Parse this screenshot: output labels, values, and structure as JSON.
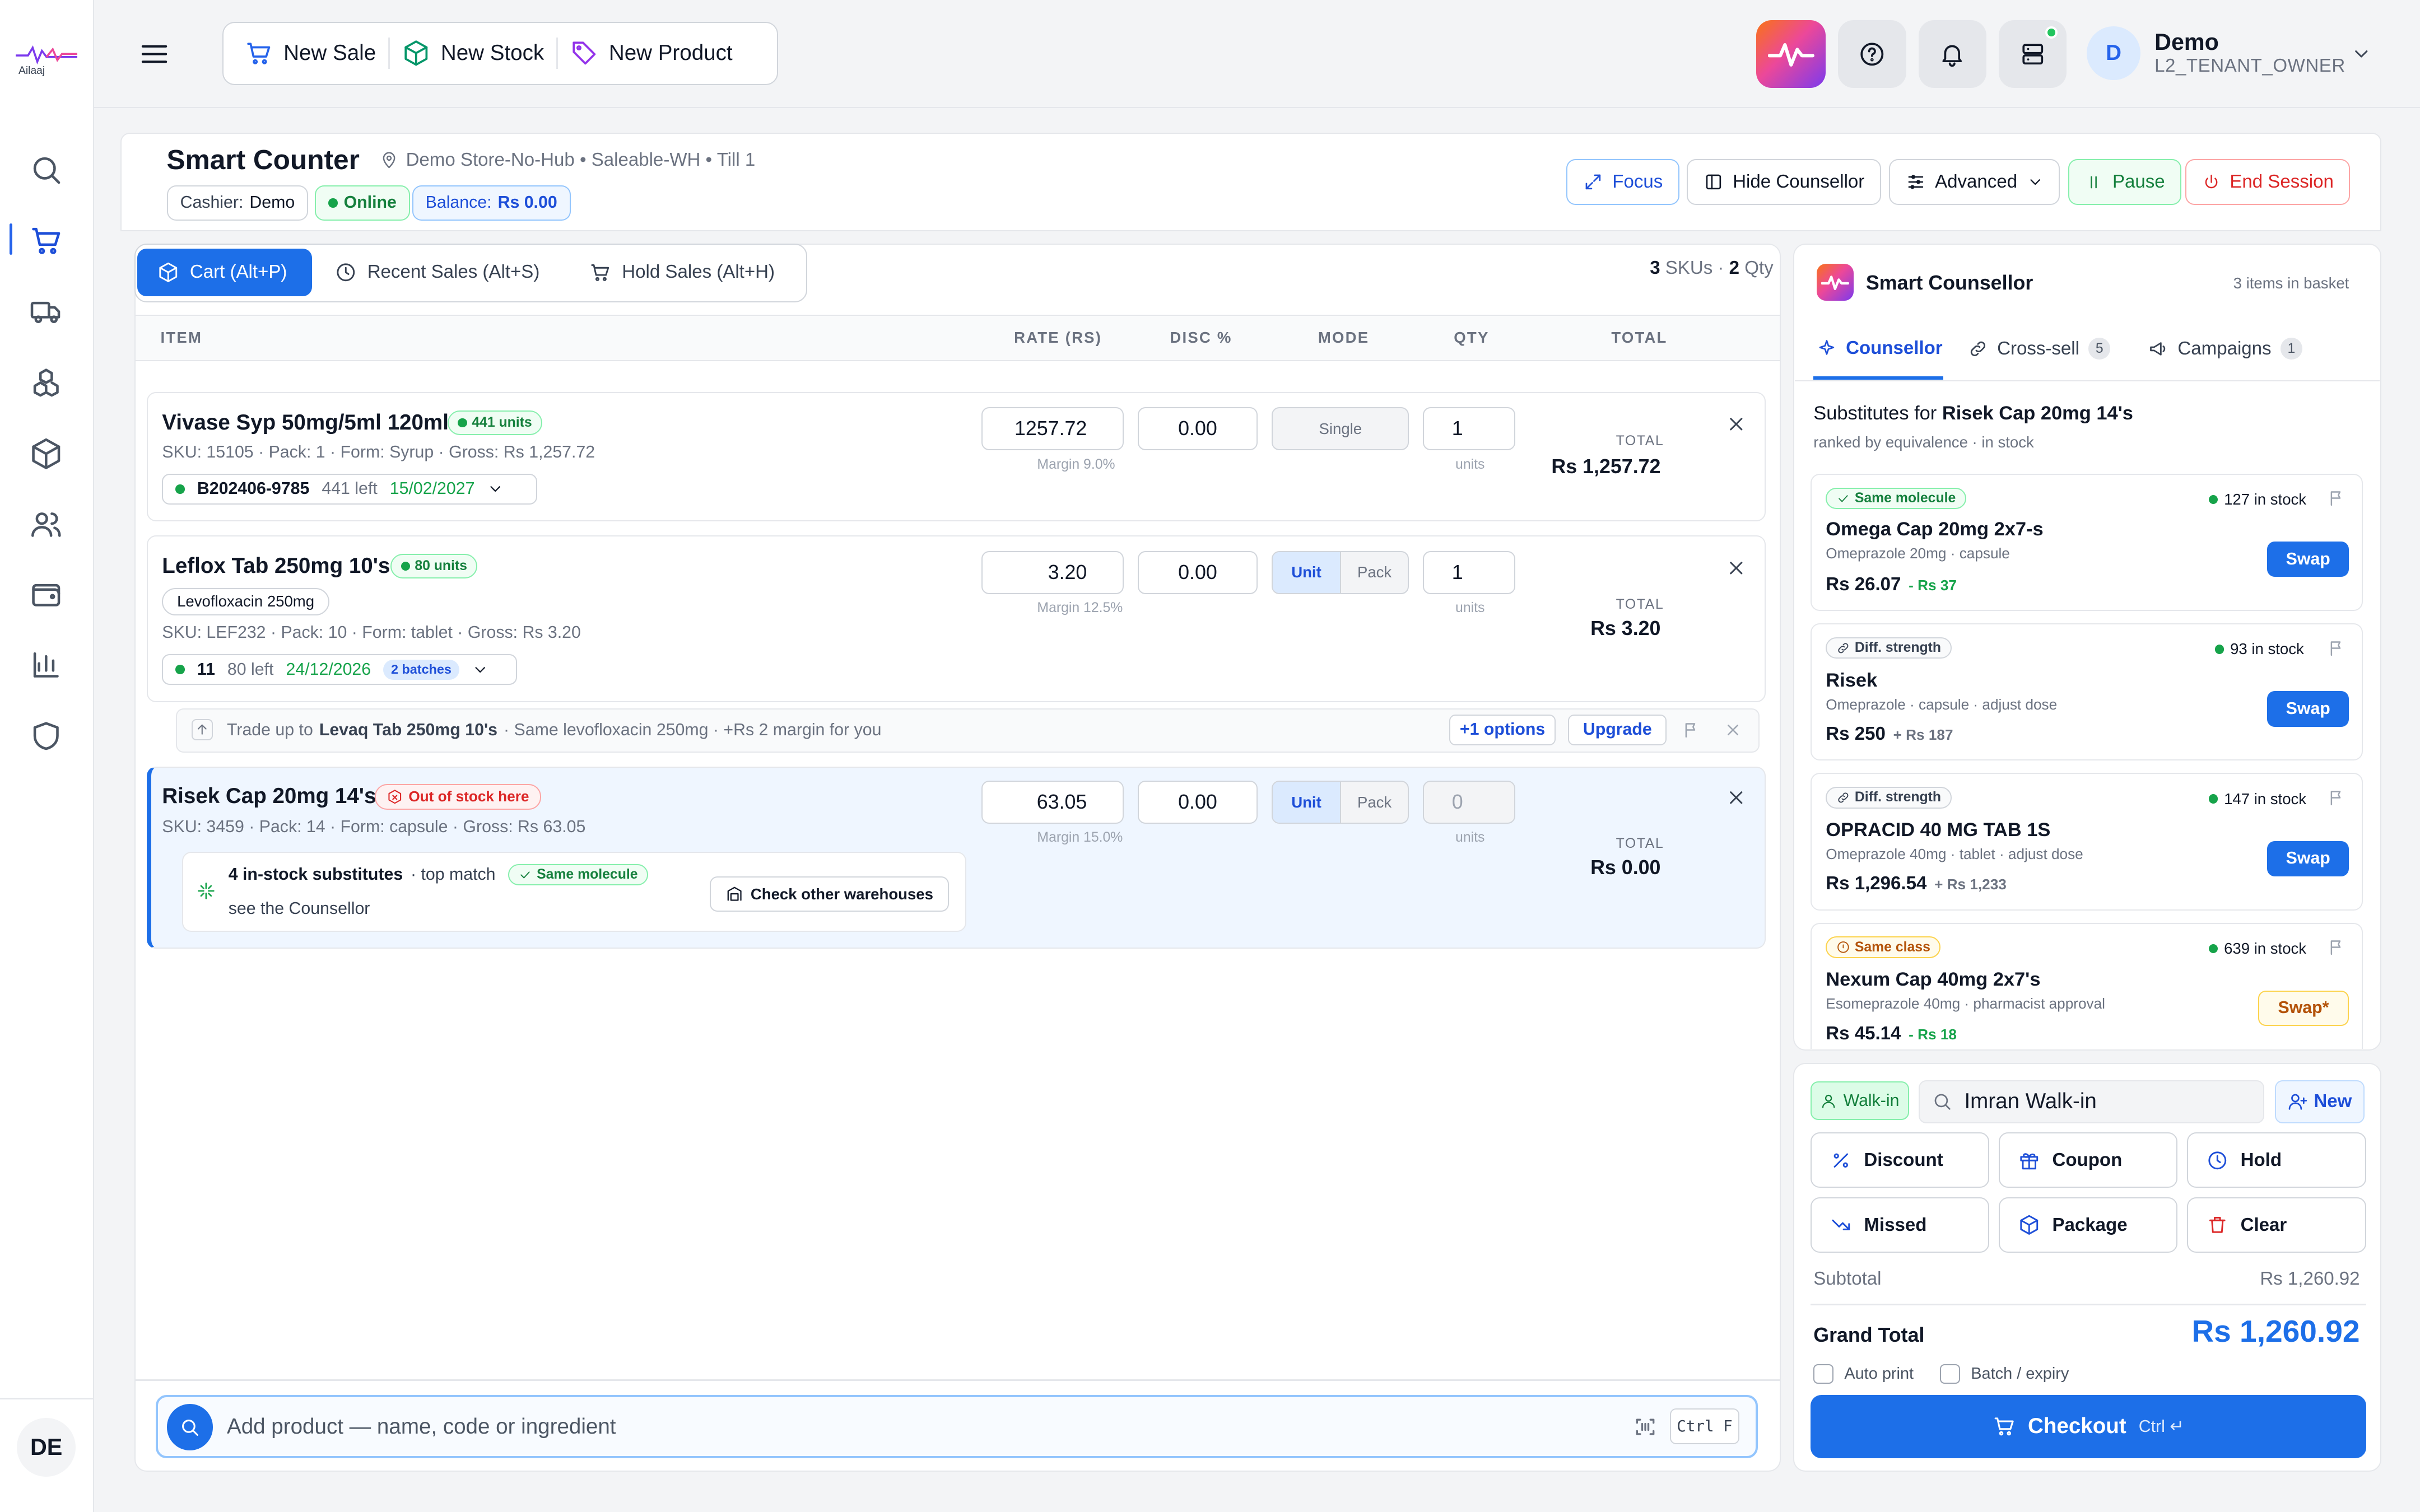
{
  "sidebar": {
    "logo_text": "Ailaaj",
    "icons": [
      "search-icon",
      "cart-icon",
      "truck-icon",
      "boxes-icon",
      "package-icon",
      "users-icon",
      "wallet-icon",
      "bar-chart-icon",
      "shield-icon"
    ],
    "avatar": "DE"
  },
  "topbar": {
    "quick": {
      "new_sale": "New Sale",
      "new_stock": "New Stock",
      "new_product": "New Product"
    },
    "user_initial": "D",
    "user_name": "Demo",
    "user_role": "L2_TENANT_OWNER"
  },
  "header": {
    "title": "Smart Counter",
    "location": "Demo Store-No-Hub • Saleable-WH • Till 1",
    "cashier_label": "Cashier:",
    "cashier_name": "Demo",
    "status": "Online",
    "balance_label": "Balance:",
    "balance_value": "Rs 0.00",
    "buttons": {
      "focus": "Focus",
      "hide_counsellor": "Hide Counsellor",
      "advanced": "Advanced",
      "pause": "Pause",
      "end_session": "End Session"
    }
  },
  "cart": {
    "tabs": {
      "cart": "Cart (Alt+P)",
      "recent": "Recent Sales (Alt+S)",
      "hold": "Hold Sales (Alt+H)"
    },
    "sku_count": "3",
    "sku_label": "SKUs ·",
    "qty_count": "2",
    "qty_label": "Qty",
    "columns": {
      "item": "ITEM",
      "rate": "RATE (RS)",
      "disc": "DISC %",
      "mode": "MODE",
      "qty": "QTY",
      "total": "TOTAL"
    },
    "total_label": "TOTAL",
    "units_label": "units",
    "items": [
      {
        "name": "Vivase Syp 50mg/5ml 120ml",
        "badge": "441 units",
        "meta": "SKU: 15105 · Pack: 1 · Form: Syrup · Gross: Rs 1,257.72",
        "rate": "1257.72",
        "margin": "Margin 9.0%",
        "disc": "0.00",
        "mode": "Single",
        "qty": "1",
        "total": "Rs 1,257.72",
        "batch_code": "B202406-9785",
        "batch_left": "441 left",
        "batch_exp": "15/02/2027"
      },
      {
        "name": "Leflox Tab 250mg 10's",
        "badge": "80 units",
        "generic": "Levofloxacin 250mg",
        "meta": "SKU: LEF232 · Pack: 10 · Form: tablet · Gross: Rs 3.20",
        "rate": "3.20",
        "margin": "Margin 12.5%",
        "disc": "0.00",
        "mode_on": "Unit",
        "mode_off": "Pack",
        "qty": "1",
        "total": "Rs 3.20",
        "batch_code": "11",
        "batch_left": "80 left",
        "batch_exp": "24/12/2026",
        "batch_count": "2 batches",
        "upsell_prefix": "Trade up to",
        "upsell_product": "Levaq Tab 250mg 10's",
        "upsell_suffix": "· Same levofloxacin 250mg · +Rs 2 margin for you",
        "upsell_options": "+1 options",
        "upsell_btn": "Upgrade"
      },
      {
        "name": "Risek Cap 20mg 14's",
        "badge": "Out of stock here",
        "meta": "SKU: 3459 · Pack: 14 · Form: capsule · Gross: Rs 63.05",
        "rate": "63.05",
        "margin": "Margin 15.0%",
        "disc": "0.00",
        "mode_on": "Unit",
        "mode_off": "Pack",
        "qty_placeholder": "0",
        "total": "Rs 0.00",
        "subs_title": "4 in-stock substitutes",
        "subs_match": "· top match",
        "subs_tag": "Same molecule",
        "subs_hint": "see the Counsellor",
        "check_wh": "Check other warehouses"
      }
    ],
    "search_placeholder": "Add product — name, code or ingredient",
    "search_kbd": "Ctrl F"
  },
  "counsellor": {
    "title": "Smart Counsellor",
    "basket": "3 items in basket",
    "tabs": {
      "counsellor": "Counsellor",
      "crosssell": "Cross-sell",
      "crosssell_count": "5",
      "campaigns": "Campaigns",
      "campaigns_count": "1"
    },
    "subs_for": "Substitutes for",
    "subs_target": "Risek Cap 20mg 14's",
    "subs_sub": "ranked by equivalence · in stock",
    "cards": [
      {
        "tag": "Same molecule",
        "stock": "127 in stock",
        "name": "Omega Cap 20mg 2x7-s",
        "desc": "Omeprazole 20mg · capsule",
        "price": "Rs 26.07",
        "diff": "- Rs 37",
        "btn": "Swap"
      },
      {
        "tag": "Diff. strength",
        "stock": "93 in stock",
        "name": "Risek",
        "desc": "Omeprazole · capsule · adjust dose",
        "price": "Rs 250",
        "diff": "+ Rs 187",
        "btn": "Swap"
      },
      {
        "tag": "Diff. strength",
        "stock": "147 in stock",
        "name": "OPRACID 40 MG TAB 1S",
        "desc": "Omeprazole 40mg · tablet · adjust dose",
        "price": "Rs 1,296.54",
        "diff": "+ Rs 1,233",
        "btn": "Swap"
      },
      {
        "tag": "Same class",
        "stock": "639 in stock",
        "name": "Nexum Cap 40mg 2x7's",
        "desc": "Esomeprazole 40mg · pharmacist approval",
        "price": "Rs 45.14",
        "diff": "- Rs 18",
        "btn": "Swap*"
      }
    ]
  },
  "payment": {
    "walkin": "Walk-in",
    "customer": "Imran Walk-in",
    "new": "New",
    "actions": {
      "discount": "Discount",
      "coupon": "Coupon",
      "hold": "Hold",
      "missed": "Missed",
      "package": "Package",
      "clear": "Clear"
    },
    "subtotal_label": "Subtotal",
    "subtotal_value": "Rs 1,260.92",
    "grand_label": "Grand Total",
    "grand_value": "Rs 1,260.92",
    "auto_print": "Auto print",
    "batch_expiry": "Batch / expiry",
    "checkout": "Checkout",
    "checkout_hint": "Ctrl ↵"
  },
  "colors": {
    "primary": "#1d6fe8",
    "success": "#16a34a",
    "danger": "#dc2626",
    "warning": "#b45309"
  }
}
